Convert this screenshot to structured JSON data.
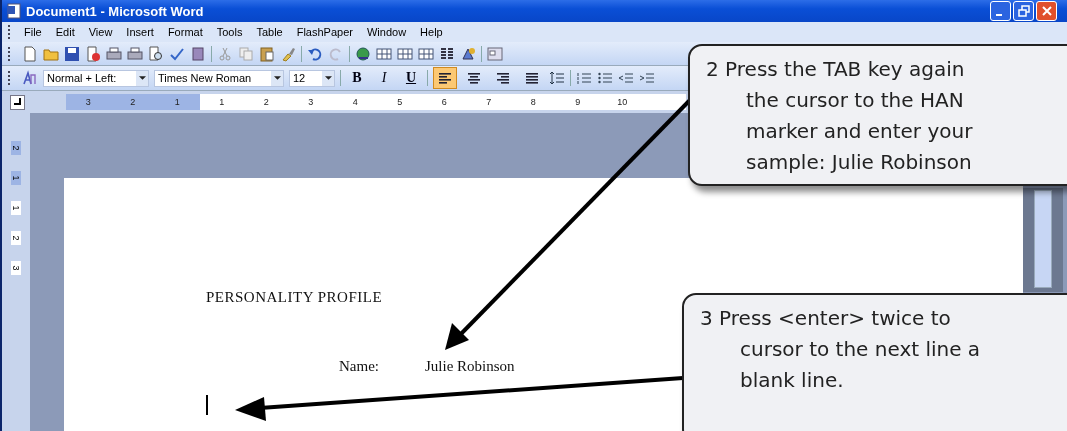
{
  "window": {
    "title": "Document1 - Microsoft Word"
  },
  "menu": [
    "File",
    "Edit",
    "View",
    "Insert",
    "Format",
    "Tools",
    "Table",
    "FlashPaper",
    "Window",
    "Help"
  ],
  "format_toolbar": {
    "style": "Normal + Left:",
    "font": "Times New Roman",
    "size": "12",
    "text_buttons": [
      {
        "kind": "bold",
        "label": "B"
      },
      {
        "kind": "italic",
        "label": "I"
      },
      {
        "kind": "underline",
        "label": "U"
      }
    ],
    "align": [
      {
        "kind": "left",
        "selected": true
      },
      {
        "kind": "center",
        "selected": false
      },
      {
        "kind": "right",
        "selected": false
      },
      {
        "kind": "justify",
        "selected": false
      }
    ]
  },
  "ruler": [
    "3",
    "2",
    "1",
    "1",
    "2",
    "3",
    "4",
    "5",
    "6",
    "7",
    "8",
    "9",
    "10"
  ],
  "vertical_ruler": [
    "2",
    "1",
    "1",
    "2",
    "3"
  ],
  "document": {
    "heading": "PERSONALITY PROFILE",
    "name_label": "Name:",
    "name_value": "Julie Robinson"
  },
  "callouts": [
    {
      "lines": [
        "2  Press the TAB key again",
        "the cursor to the HAN",
        "marker and enter your",
        "sample: Julie Robinson"
      ]
    },
    {
      "lines": [
        "3  Press <enter> twice to",
        "cursor to the next line a",
        "blank line."
      ]
    }
  ]
}
